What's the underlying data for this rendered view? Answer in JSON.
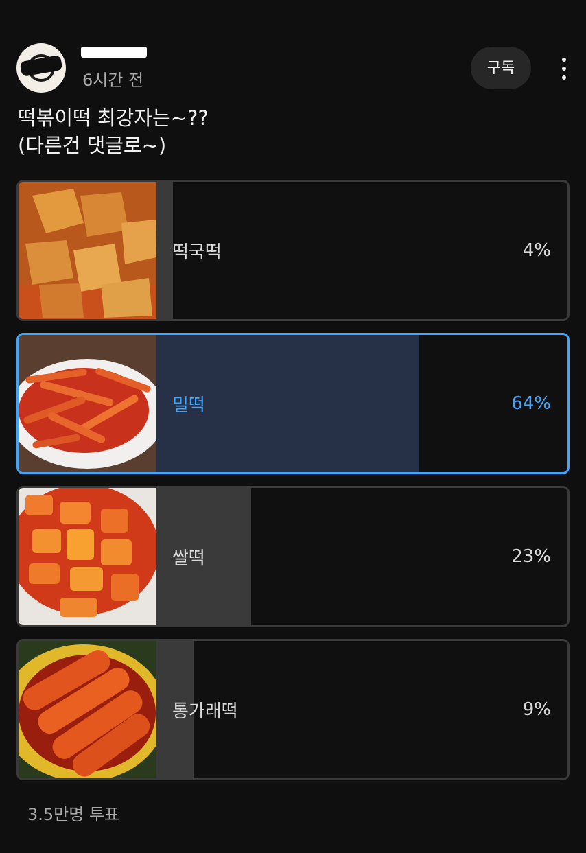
{
  "post": {
    "time": "6시간 전",
    "subscribe_label": "구독",
    "text_line1": "떡볶이떡 최강자는~??",
    "text_line2": "(다른건 댓글로~)"
  },
  "poll": {
    "options": [
      {
        "label": "떡국떡",
        "percent": "4%",
        "value": 4,
        "selected": false,
        "image": "rice-cake-slices-photo"
      },
      {
        "label": "밀떡",
        "percent": "64%",
        "value": 64,
        "selected": true,
        "image": "wheat-rice-cake-photo"
      },
      {
        "label": "쌀떡",
        "percent": "23%",
        "value": 23,
        "selected": false,
        "image": "rice-rice-cake-photo"
      },
      {
        "label": "통가래떡",
        "percent": "9%",
        "value": 9,
        "selected": false,
        "image": "whole-rice-cake-photo"
      }
    ],
    "vote_count": "3.5만명 투표"
  },
  "colors": {
    "background": "#0f0f0f",
    "accent": "#3ea6ff",
    "bar": "#3a3a3a",
    "selected_bar": "#263046"
  }
}
